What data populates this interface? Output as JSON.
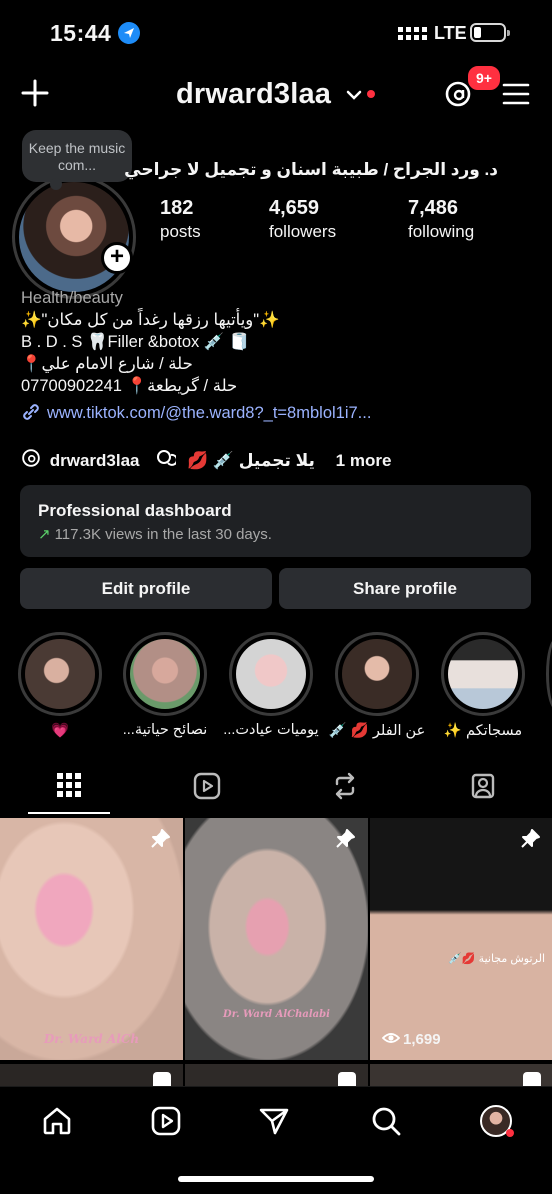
{
  "status_bar": {
    "time": "15:44",
    "network": "LTE"
  },
  "header": {
    "username": "drward3laa",
    "notification_badge": "9+"
  },
  "profile": {
    "note": "Keep the music com...",
    "full_name": "د. ورد الجراح / طبيبة اسنان و تجميل لا جراحي",
    "stats": [
      {
        "value": "182",
        "label": "posts"
      },
      {
        "value": "4,659",
        "label": "followers"
      },
      {
        "value": "7,486",
        "label": "following"
      }
    ],
    "category": "Health/beauty",
    "bio_lines": [
      "✨\"ويأتيها رزقها رغداً من كل مكان\"✨",
      "B . D . S 🦷Filler &botox 💉 🧻",
      "📍حلة / شارع الامام علي",
      "07700902241 📍حلة / گريطعة"
    ],
    "link": "www.tiktok.com/@the.ward8?_t=8mblol1i7...",
    "threads_handle": "drward3laa",
    "mention_label": "يلا تجميل 💉 💋",
    "more": "1 more"
  },
  "dashboard": {
    "title": "Professional dashboard",
    "subtitle": "117.3K views in the last 30 days."
  },
  "buttons": {
    "edit": "Edit profile",
    "share": "Share profile"
  },
  "highlights": [
    {
      "caption": "💗"
    },
    {
      "caption": "نصائح حياتية..."
    },
    {
      "caption": "يوميات عيادت..."
    },
    {
      "caption": "عن الفلر 💋 💉"
    },
    {
      "caption": "مسجاتكم ✨"
    }
  ],
  "posts": [
    {
      "watermark": "Dr. Ward AlCh",
      "pinned": true
    },
    {
      "watermark": "Dr. Ward AlChalabi",
      "pinned": true
    },
    {
      "tag": "الرتوش مجانية 💋💉",
      "views": "1,699",
      "pinned": true
    }
  ],
  "colors": {
    "background": "#000000",
    "link": "#9bb3ff",
    "badge": "#ff3040",
    "positive": "#5bd16a"
  }
}
